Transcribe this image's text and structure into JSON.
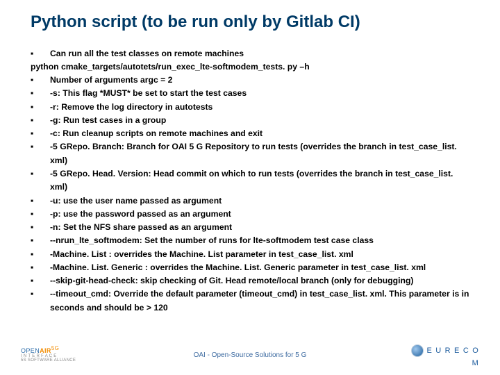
{
  "title": "Python script (to be run only by Gitlab CI)",
  "intro_bullet": "Can run all the test classes on remote machines",
  "command_line": "python cmake_targets/autotets/run_exec_lte-softmodem_tests. py –h",
  "bullets": [
    "Number of arguments argc = 2",
    "-s:  This flag *MUST* be set to start the test cases",
    "-r:  Remove the log directory in autotests",
    "-g:  Run test cases in a group",
    "-c:  Run cleanup scripts on remote machines and exit",
    "-5 GRepo. Branch:  Branch for OAI 5 G Repository to run tests (overrides the branch in test_case_list. xml)",
    "-5 GRepo. Head. Version:  Head commit on which to run tests (overrides the branch in test_case_list. xml)",
    "-u:  use the user name passed as argument",
    "-p:  use the password passed as an argument",
    "-n:  Set the NFS share passed as an argument",
    "--nrun_lte_softmodem:  Set the number of runs for lte-softmodem test case class",
    "-Machine. List :  overrides the Machine. List parameter in test_case_list. xml",
    "-Machine. List. Generic :  overrides the Machine. List. Generic  parameter in test_case_list. xml",
    "--skip-git-head-check: skip checking of Git. Head remote/local branch (only for debugging)",
    "--timeout_cmd: Override the default parameter (timeout_cmd) in test_case_list. xml. This parameter is in seconds and should be > 120"
  ],
  "footer": {
    "center": "OAI - Open-Source Solutions for 5 G",
    "oai": {
      "open": "OPEN",
      "air": "AIR",
      "five_g": "5G",
      "sub": "I N T E R F A C E",
      "alliance": "5S SOFTWARE ALLIANCE"
    },
    "eurecom": "E U R E C O M"
  }
}
